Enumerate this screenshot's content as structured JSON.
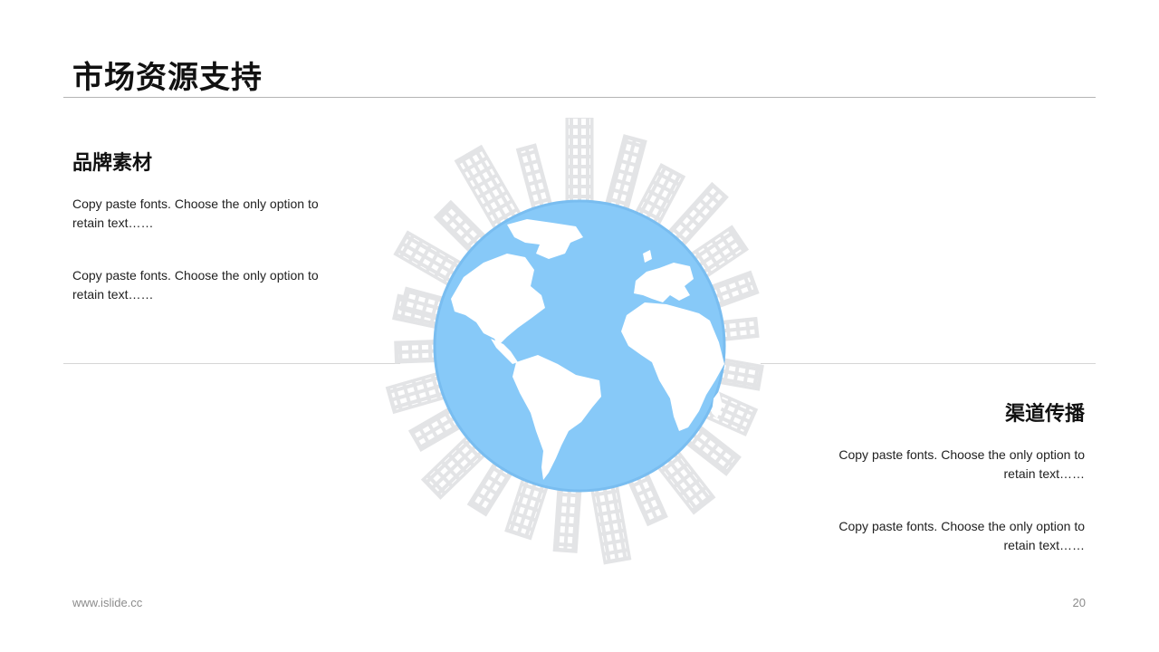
{
  "slide": {
    "title": "市场资源支持",
    "page_number": "20",
    "footer_url": "www.islide.cc"
  },
  "brand_section": {
    "heading": "品牌素材",
    "paragraphs": [
      "Copy paste fonts. Choose the only option to retain text……",
      "Copy paste fonts. Choose the only option to retain text……"
    ]
  },
  "channel_section": {
    "heading": "渠道传播",
    "paragraphs": [
      "Copy paste fonts. Choose the only option to retain text……",
      "Copy paste fonts. Choose the only option to retain text……"
    ]
  },
  "illustration": {
    "icon": "globe-with-city-skyline-icon",
    "ocean_color": "#87c9f8",
    "land_color": "#ffffff",
    "building_color": "#e3e4e6"
  }
}
